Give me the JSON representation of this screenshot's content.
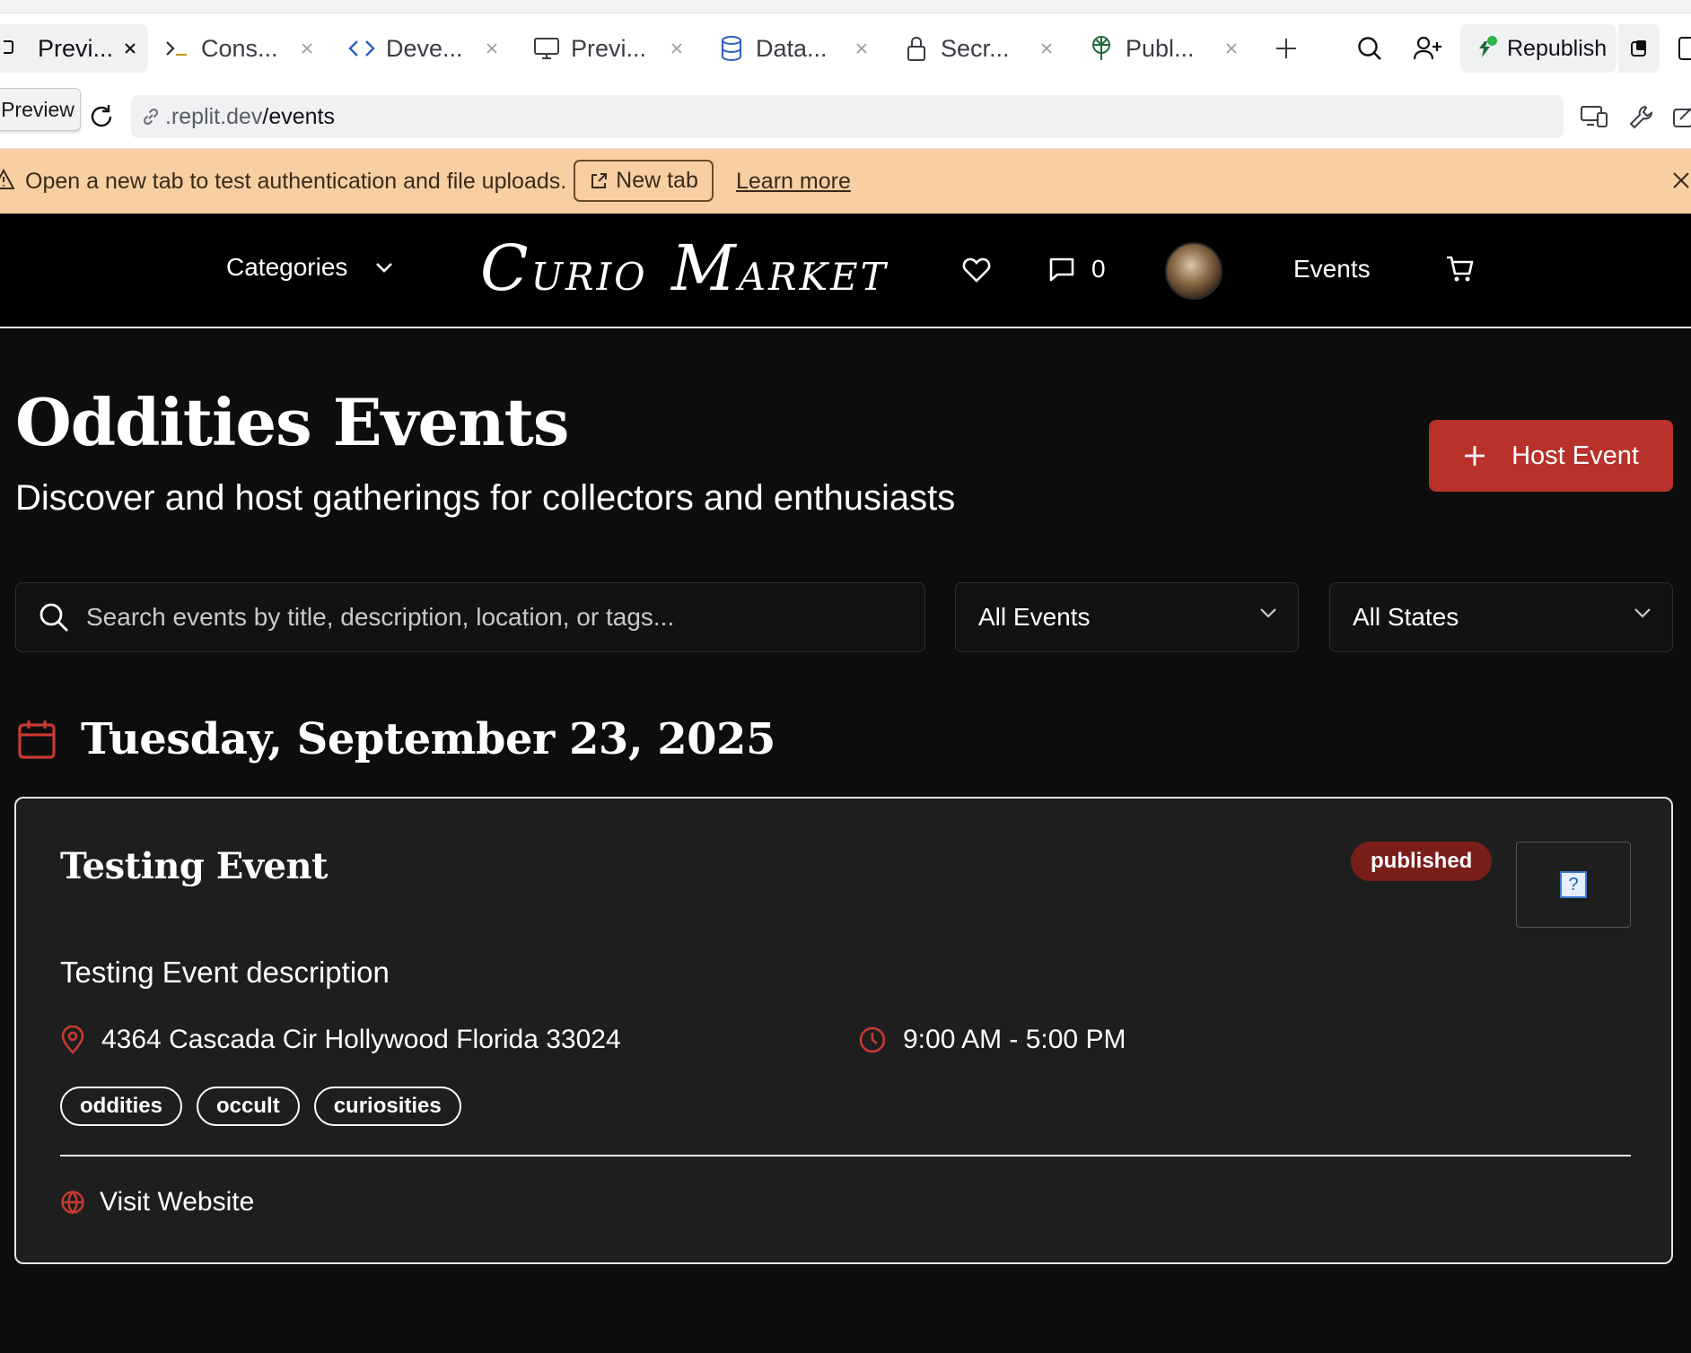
{
  "ide": {
    "tabs": [
      {
        "label": "Previ...",
        "icon": "monitor-icon",
        "active": true
      },
      {
        "label": "Cons...",
        "icon": "terminal-icon"
      },
      {
        "label": "Deve...",
        "icon": "code-icon"
      },
      {
        "label": "Previ...",
        "icon": "monitor-icon"
      },
      {
        "label": "Data...",
        "icon": "database-icon"
      },
      {
        "label": "Secr...",
        "icon": "lock-icon"
      },
      {
        "label": "Publ...",
        "icon": "publish-icon"
      }
    ],
    "republish_label": "Republish",
    "preview_chip": "Preview",
    "url_host": ".replit.dev",
    "url_path": "/events"
  },
  "banner": {
    "message": "Open a new tab to test authentication and file uploads.",
    "new_tab_label": "New tab",
    "learn_more_label": "Learn more"
  },
  "nav": {
    "categories_label": "Categories",
    "logo": {
      "c": "C",
      "urio": "URIO",
      "m": "M",
      "arket": "ARKET"
    },
    "message_count": "0",
    "events_label": "Events"
  },
  "page": {
    "title": "Oddities Events",
    "subtitle": "Discover and host gatherings for collectors and enthusiasts",
    "host_button": "Host Event",
    "search_placeholder": "Search events by title, description, location, or tags...",
    "filter_events": "All Events",
    "filter_states": "All States",
    "date_heading": "Tuesday, September 23, 2025"
  },
  "event": {
    "title": "Testing Event",
    "status": "published",
    "description": "Testing Event description",
    "location": "4364 Cascada Cir Hollywood Florida 33024",
    "time": "9:00 AM - 5:00 PM",
    "tags": [
      "oddities",
      "occult",
      "curiosities"
    ],
    "website_label": "Visit Website"
  },
  "colors": {
    "accent_red": "#b8312b",
    "badge_red": "#7a1e1a",
    "banner_bg": "#f8cfa2",
    "page_bg": "#0d0d0d",
    "card_bg": "#1e1e1e"
  }
}
